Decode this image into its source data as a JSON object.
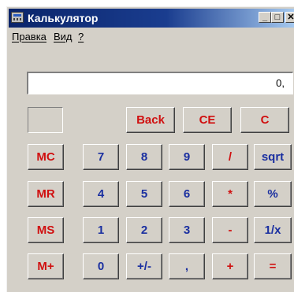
{
  "window": {
    "title": "Калькулятор"
  },
  "menu": {
    "edit": "Правка",
    "view": "Вид",
    "help": "?"
  },
  "caption_buttons": {
    "minimize": "_",
    "maximize": "□",
    "close": "✕"
  },
  "display": {
    "value": "0,"
  },
  "memory": {
    "indicator": ""
  },
  "keys": {
    "backspace": "Back",
    "ce": "CE",
    "c": "C",
    "mc": "MC",
    "mr": "MR",
    "ms": "MS",
    "mplus": "M+",
    "d7": "7",
    "d8": "8",
    "d9": "9",
    "div": "/",
    "sqrt": "sqrt",
    "d4": "4",
    "d5": "5",
    "d6": "6",
    "mul": "*",
    "percent": "%",
    "d1": "1",
    "d2": "2",
    "d3": "3",
    "sub": "-",
    "recip": "1/x",
    "d0": "0",
    "sign": "+/-",
    "dot": ",",
    "add": "+",
    "eq": "="
  },
  "colors": {
    "title_bar": "#0a246a",
    "button_face": "#d4d0c8",
    "operator_text": "#d01010",
    "digit_text": "#1a2fa0"
  }
}
